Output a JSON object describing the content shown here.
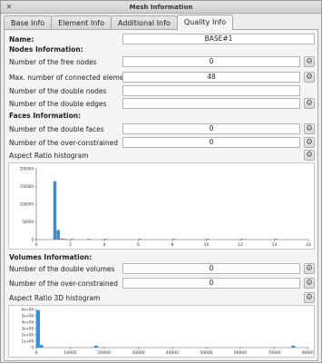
{
  "window": {
    "title": "Mesh Information",
    "close_glyph": "✕"
  },
  "tabs": [
    {
      "label": "Base Info",
      "active": false
    },
    {
      "label": "Element Info",
      "active": false
    },
    {
      "label": "Additional Info",
      "active": false
    },
    {
      "label": "Quality Info",
      "active": true
    }
  ],
  "name": {
    "label": "Name:",
    "value": "BASE#1"
  },
  "nodes": {
    "header": "Nodes Information:",
    "free_nodes": {
      "label": "Number of the free nodes",
      "value": "0"
    },
    "max_connected": {
      "label": "Max. number of connected elements",
      "value": "48"
    },
    "double_nodes": {
      "label": "Number of the double nodes",
      "value": ""
    },
    "double_edges": {
      "label": "Number of the double edges",
      "value": ""
    }
  },
  "faces": {
    "header": "Faces Information:",
    "double_faces": {
      "label": "Number of the double faces",
      "value": "0"
    },
    "over_constrained": {
      "label": "Number of the over-constrained",
      "value": "0"
    },
    "histogram_label": "Aspect Ratio histogram"
  },
  "volumes": {
    "header": "Volumes Information:",
    "double_volumes": {
      "label": "Number of the double volumes",
      "value": "0"
    },
    "over_constrained": {
      "label": "Number of the over-constrained",
      "value": "0"
    },
    "histogram_label": "Aspect Ratio 3D histogram"
  },
  "colors": {
    "bar": "#3a8fd0"
  },
  "icons": {
    "compute": "gear-icon"
  },
  "chart_data": [
    {
      "type": "bar",
      "title": "",
      "xlabel": "",
      "ylabel": "",
      "xlim": [
        0,
        16
      ],
      "ylim": [
        0,
        200000
      ],
      "xticks": [
        "0",
        "2",
        "4",
        "6",
        "8",
        "10",
        "12",
        "14",
        "16"
      ],
      "yticks": [
        "0",
        "50000",
        "100000",
        "150000",
        "200000"
      ],
      "bins": [
        {
          "x": 1.0,
          "value": 165000
        },
        {
          "x": 1.2,
          "value": 27000
        },
        {
          "x": 1.4,
          "value": 3000
        },
        {
          "x": 1.6,
          "value": 1000
        },
        {
          "x": 2.0,
          "value": 400
        },
        {
          "x": 3.0,
          "value": 300
        },
        {
          "x": 4.0,
          "value": 200
        },
        {
          "x": 6.0,
          "value": 150
        },
        {
          "x": 8.0,
          "value": 120
        },
        {
          "x": 10.0,
          "value": 100
        },
        {
          "x": 12.0,
          "value": 90
        },
        {
          "x": 14.0,
          "value": 80
        }
      ],
      "grid": false
    },
    {
      "type": "bar",
      "title": "",
      "xlabel": "",
      "ylabel": "",
      "xlim": [
        0,
        80000
      ],
      "ylim": [
        0,
        6000000
      ],
      "xticks": [
        "0",
        "10000",
        "20000",
        "30000",
        "40000",
        "50000",
        "60000",
        "70000",
        "80000"
      ],
      "yticks": [
        "0",
        "1e+06",
        "2e+06",
        "3e+06",
        "4e+06",
        "5e+06",
        "6e+06"
      ],
      "bins": [
        {
          "x": 0,
          "value": 5900000
        },
        {
          "x": 1000,
          "value": 400000
        },
        {
          "x": 17000,
          "value": 300000
        },
        {
          "x": 75000,
          "value": 300000
        }
      ],
      "grid": false
    }
  ]
}
